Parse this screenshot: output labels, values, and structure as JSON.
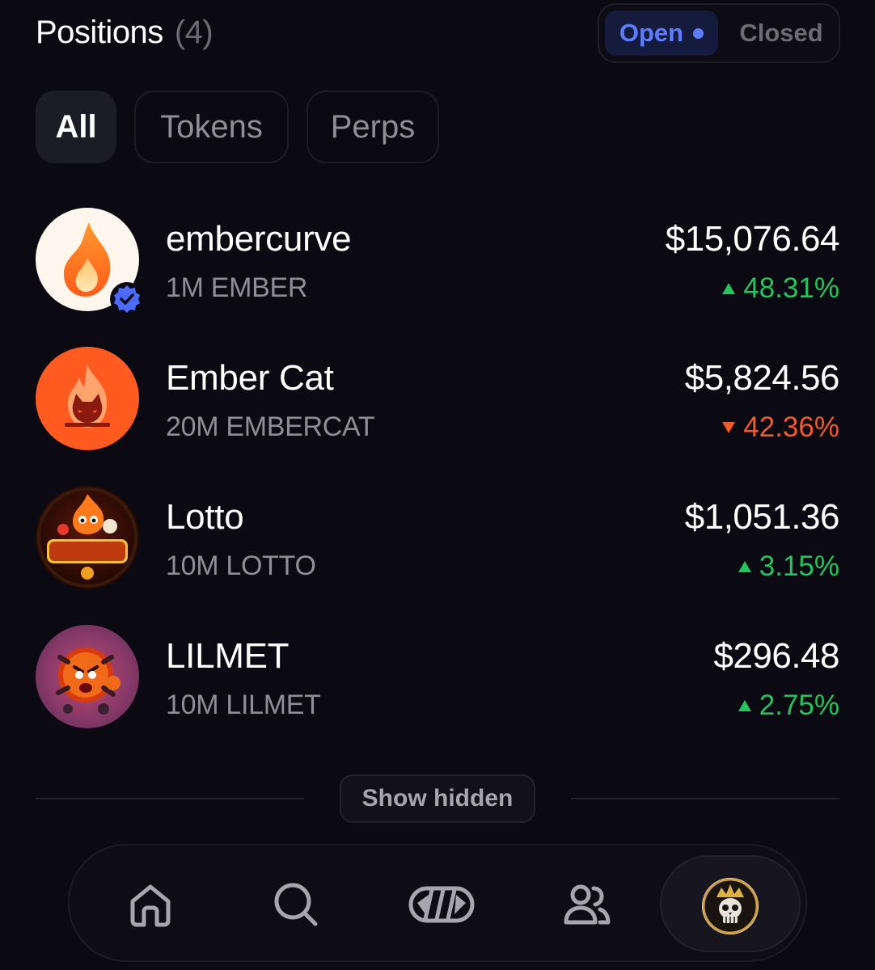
{
  "header": {
    "title": "Positions",
    "count": "(4)",
    "toggle": {
      "open_label": "Open",
      "closed_label": "Closed",
      "active": "Open"
    }
  },
  "filters": [
    {
      "label": "All",
      "active": true
    },
    {
      "label": "Tokens",
      "active": false
    },
    {
      "label": "Perps",
      "active": false
    }
  ],
  "positions": [
    {
      "name": "embercurve",
      "quantity": "1M EMBER",
      "value": "$15,076.64",
      "change": "48.31%",
      "direction": "up",
      "verified": true,
      "icon": "flame-drop-icon"
    },
    {
      "name": "Ember Cat",
      "quantity": "20M EMBERCAT",
      "value": "$5,824.56",
      "change": "42.36%",
      "direction": "down",
      "verified": false,
      "icon": "fire-cat-icon"
    },
    {
      "name": "Lotto",
      "quantity": "10M LOTTO",
      "value": "$1,051.36",
      "change": "3.15%",
      "direction": "up",
      "verified": false,
      "icon": "lotto-logo-icon"
    },
    {
      "name": "LILMET",
      "quantity": "10M LILMET",
      "value": "$296.48",
      "change": "2.75%",
      "direction": "up",
      "verified": false,
      "icon": "angry-meteor-icon"
    }
  ],
  "show_hidden_label": "Show hidden",
  "nav": {
    "items": [
      "home-icon",
      "search-icon",
      "trade-icon",
      "people-icon",
      "profile-avatar"
    ],
    "active": "profile-avatar"
  },
  "colors": {
    "background": "#0b0a12",
    "accent": "#5d7cff",
    "positive": "#22c55e",
    "negative": "#f25a2a",
    "muted": "#8f8e96"
  }
}
